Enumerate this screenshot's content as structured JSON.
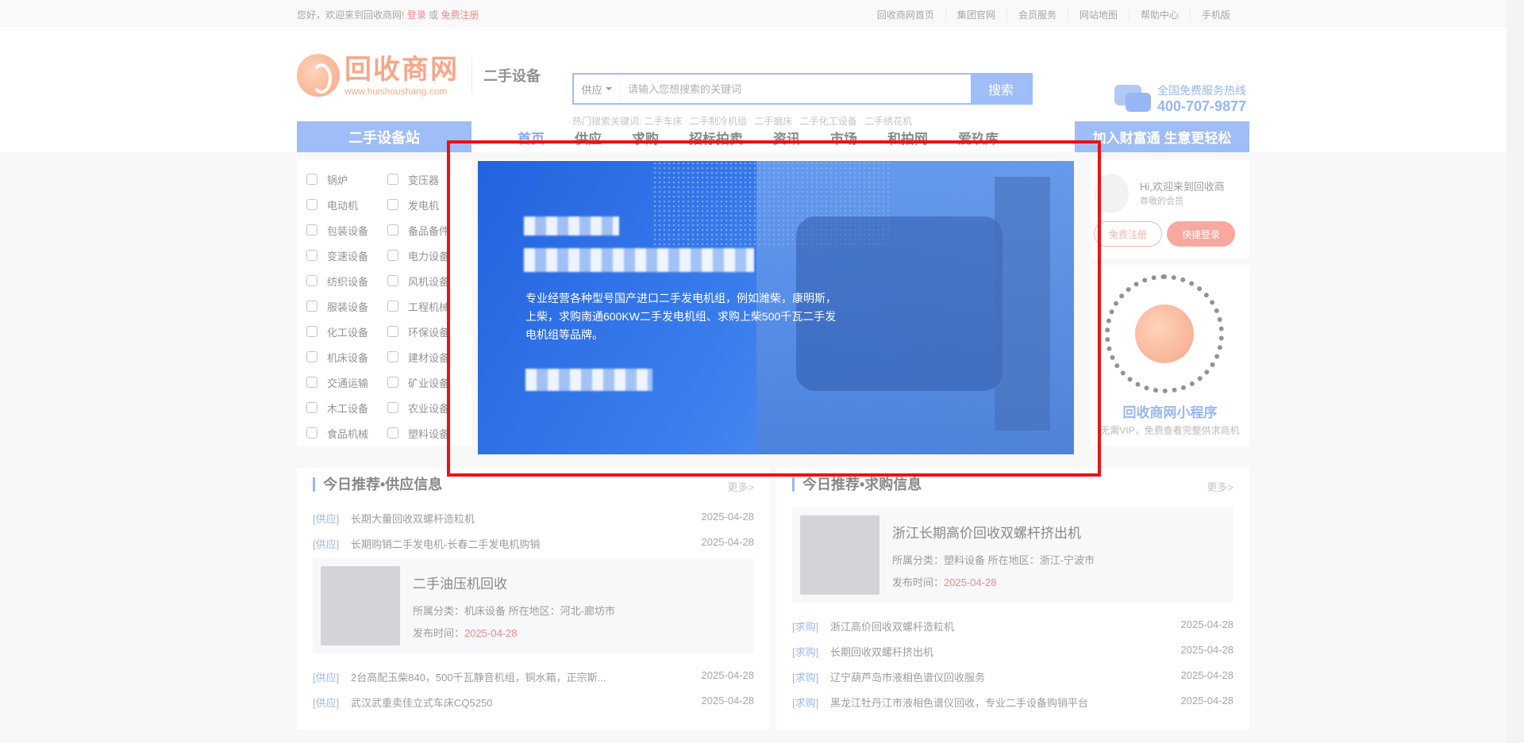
{
  "topbar": {
    "welcome": "您好，欢迎来到回收商网!",
    "login": "登录",
    "or": "或",
    "register": "免费注册",
    "links": [
      "回收商网首页",
      "集团官网",
      "会员服务",
      "网站地图",
      "帮助中心",
      "手机版"
    ]
  },
  "header": {
    "logo_cn": "回收商网",
    "logo_en": "www.huishoushang.com",
    "subtitle": "二手设备",
    "search": {
      "select": "供应",
      "placeholder": "请输入您想搜索的关键词",
      "button": "搜索"
    },
    "hot_label": "热门搜索关键词:",
    "hot_keywords": [
      "二手车床",
      "二手制冷机组",
      "二手磨床",
      "二手化工设备",
      "二手绣花机"
    ],
    "hotline_label": "全国免费服务热线",
    "hotline_number": "400-707-9877"
  },
  "nav": {
    "site": "二手设备站",
    "items": [
      "首页",
      "供应",
      "求购",
      "招标拍卖",
      "资讯",
      "市场",
      "和拍网",
      "爱玖库"
    ],
    "cta": "加入财富通 生意更轻松"
  },
  "categories": [
    [
      "锅炉",
      "变压器"
    ],
    [
      "电动机",
      "发电机"
    ],
    [
      "包装设备",
      "备品备件"
    ],
    [
      "变速设备",
      "电力设备"
    ],
    [
      "纺织设备",
      "风机设备"
    ],
    [
      "服装设备",
      "工程机械"
    ],
    [
      "化工设备",
      "环保设备"
    ],
    [
      "机床设备",
      "建材设备"
    ],
    [
      "交通运输",
      "矿业设备"
    ],
    [
      "木工设备",
      "农业设备"
    ],
    [
      "食品机械",
      "塑料设备"
    ]
  ],
  "user": {
    "hi": "Hi,欢迎来到回收商",
    "vip": "尊敬的会员",
    "register": "免费注册",
    "login": "快捷登录"
  },
  "mini": {
    "name": "回收商网小程序",
    "desc": "无需VIP，免费查看完整供求商机"
  },
  "supply": {
    "title": "今日推荐•供应信息",
    "more": "更多>",
    "items_top": [
      {
        "tag": "[供应]",
        "title": "长期大量回收双螺杆造粒机",
        "date": "2025-04-28"
      },
      {
        "tag": "[供应]",
        "title": "长期购销二手发电机-长春二手发电机购销",
        "date": "2025-04-28"
      }
    ],
    "featured": {
      "title": "二手油压机回收",
      "meta": "所属分类：机床设备  所在地区：河北-廊坊市",
      "date_label": "发布时间：",
      "date": "2025-04-28"
    },
    "items_bottom": [
      {
        "tag": "[供应]",
        "title": "2台高配玉柴840，500千瓦静音机组，铜水箱，正宗斯...",
        "date": "2025-04-28"
      },
      {
        "tag": "[供应]",
        "title": "武汉武重卖佳立式车床CQ5250",
        "date": "2025-04-28"
      }
    ]
  },
  "demand": {
    "title": "今日推荐•求购信息",
    "more": "更多>",
    "featured": {
      "title": "浙江长期高价回收双螺杆挤出机",
      "meta": "所属分类：塑料设备  所在地区：浙江-宁波市",
      "date_label": "发布时间：",
      "date": "2025-04-28"
    },
    "items": [
      {
        "tag": "[求购]",
        "title": "浙江高价回收双螺杆造粒机",
        "date": "2025-04-28"
      },
      {
        "tag": "[求购]",
        "title": "长期回收双螺杆挤出机",
        "date": "2025-04-28"
      },
      {
        "tag": "[求购]",
        "title": "辽宁葫芦岛市液相色谱仪回收服务",
        "date": "2025-04-28"
      },
      {
        "tag": "[求购]",
        "title": "黑龙江牡丹江市液相色谱仪回收，专业二手设备购销平台",
        "date": "2025-04-28"
      }
    ]
  },
  "popup": {
    "desc": "专业经营各种型号国产进口二手发电机组，例如潍柴，康明斯，上柴，求购南通600KW二手发电机组、求购上柴500千瓦二手发电机组等品牌。"
  },
  "colors": {
    "accent": "#4d82ea",
    "brand": "#ee6a33",
    "highlight_border": "#e11111"
  }
}
